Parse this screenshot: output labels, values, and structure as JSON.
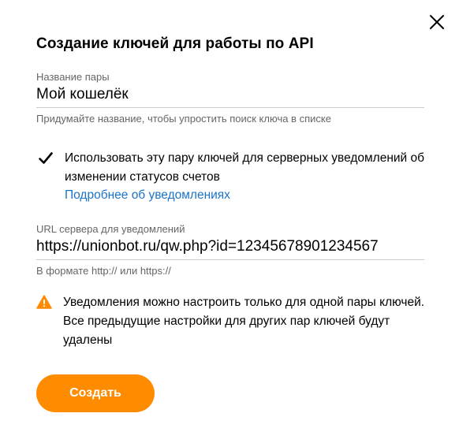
{
  "dialog": {
    "title": "Создание ключей для работы по API",
    "close_icon": "close-icon"
  },
  "name_field": {
    "label": "Название пары",
    "value": "Мой кошелёк",
    "hint": "Придумайте название, чтобы упростить поиск ключа в списке"
  },
  "notifications_checkbox": {
    "checked": true,
    "label": "Использовать эту пару ключей для серверных уведомлений об изменении статусов счетов",
    "link_text": "Подробнее об уведомлениях"
  },
  "url_field": {
    "label": "URL сервера для уведомлений",
    "value": "https://unionbot.ru/qw.php?id=12345678901234567",
    "hint": "В формате http:// или https://"
  },
  "warning": {
    "icon": "warning-icon",
    "text": "Уведомления можно настроить только для одной пары ключей. Все предыдущие настройки для других пар ключей будут удалены"
  },
  "actions": {
    "create_label": "Создать"
  },
  "colors": {
    "accent": "#ff8c00",
    "link": "#1a73c8",
    "warning": "#ff8c00",
    "hint": "#666666"
  }
}
